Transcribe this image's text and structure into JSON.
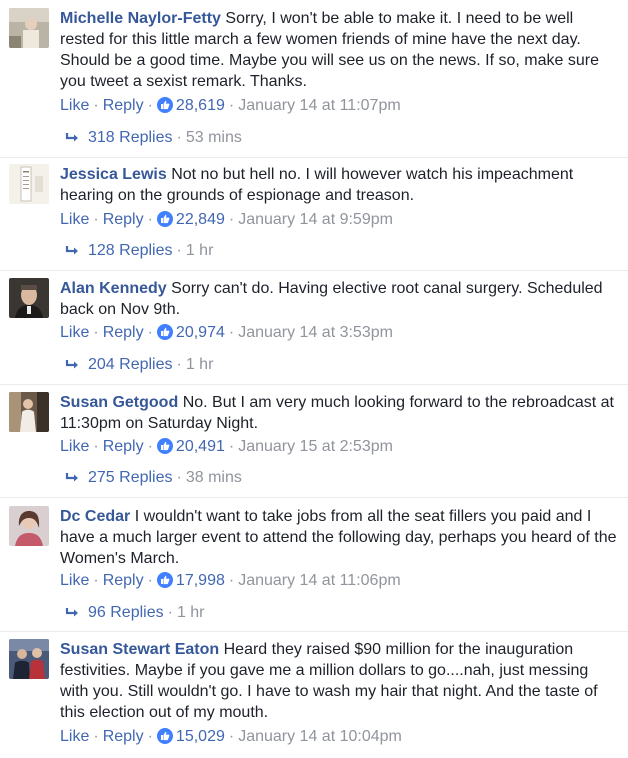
{
  "comments": [
    {
      "author": "Michelle Naylor-Fetty",
      "text": "Sorry, I won't be able to make it. I need to be well rested for this little march a few women friends of mine have the next day. Should be a good time. Maybe you will see us on the news. If so, make sure you tweet a sexist remark. Thanks.",
      "like_label": "Like",
      "reply_label": "Reply",
      "reactions": "28,619",
      "timestamp": "January 14 at 11:07pm",
      "replies_label": "318 Replies",
      "replies_age": "53 mins"
    },
    {
      "author": "Jessica Lewis",
      "text": "Not no but hell no. I will however watch his impeachment hearing on the grounds of espionage and treason.",
      "like_label": "Like",
      "reply_label": "Reply",
      "reactions": "22,849",
      "timestamp": "January 14 at 9:59pm",
      "replies_label": "128 Replies",
      "replies_age": "1 hr"
    },
    {
      "author": "Alan Kennedy",
      "text": "Sorry can't do. Having elective root canal surgery. Scheduled back on Nov 9th.",
      "like_label": "Like",
      "reply_label": "Reply",
      "reactions": "20,974",
      "timestamp": "January 14 at 3:53pm",
      "replies_label": "204 Replies",
      "replies_age": "1 hr"
    },
    {
      "author": "Susan Getgood",
      "text": "No. But I am very much looking forward to the rebroadcast at 11:30pm on Saturday Night.",
      "like_label": "Like",
      "reply_label": "Reply",
      "reactions": "20,491",
      "timestamp": "January 15 at 2:53pm",
      "replies_label": "275 Replies",
      "replies_age": "38 mins"
    },
    {
      "author": "Dc Cedar",
      "text": "I wouldn't want to take jobs from all the seat fillers you paid and I have a much larger event to attend the following day, perhaps you heard of the Women's March.",
      "like_label": "Like",
      "reply_label": "Reply",
      "reactions": "17,998",
      "timestamp": "January 14 at 11:06pm",
      "replies_label": "96 Replies",
      "replies_age": "1 hr"
    },
    {
      "author": "Susan Stewart Eaton",
      "text": "Heard they raised $90 million for the inauguration festivities. Maybe if you gave me a million dollars to go....nah, just messing with you. Still wouldn't go. I have to wash my hair that night. And the taste of this election out of my mouth.",
      "like_label": "Like",
      "reply_label": "Reply",
      "reactions": "15,029",
      "timestamp": "January 14 at 10:04pm"
    }
  ],
  "colors": {
    "author": "#365899",
    "link": "#4267b2",
    "meta": "#90949c",
    "like_badge": "#4080ff"
  }
}
